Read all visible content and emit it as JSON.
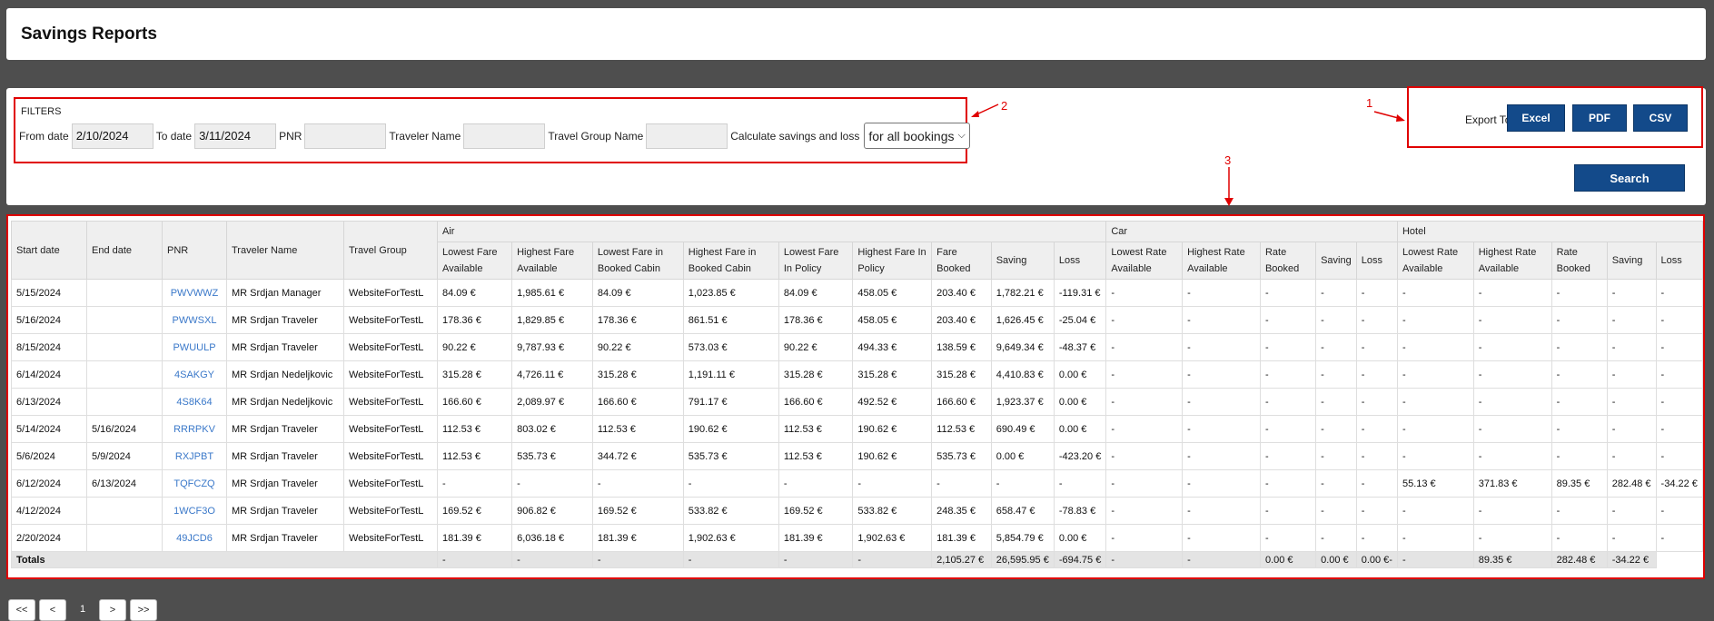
{
  "page": {
    "title": "Savings Reports"
  },
  "filters": {
    "label": "FILTERS",
    "from_date_label": "From date",
    "from_date": "2/10/2024",
    "to_date_label": "To date",
    "to_date": "3/11/2024",
    "pnr_label": "PNR",
    "pnr": "",
    "traveler_label": "Traveler Name",
    "traveler": "",
    "group_label": "Travel Group Name",
    "group": "",
    "calc_label": "Calculate savings and loss",
    "calc_value": "for all bookings"
  },
  "export": {
    "label": "Export To",
    "excel": "Excel",
    "pdf": "PDF",
    "csv": "CSV"
  },
  "search_button": "Search",
  "annotations": {
    "a1": "1",
    "a2": "2",
    "a3": "3"
  },
  "table": {
    "groups": {
      "air": "Air",
      "car": "Car",
      "hotel": "Hotel"
    },
    "headers": {
      "start": "Start date",
      "end": "End date",
      "pnr": "PNR",
      "traveler": "Traveler Name",
      "group": "Travel Group",
      "air": [
        "Lowest Fare Available",
        "Highest Fare Available",
        "Lowest Fare in Booked Cabin",
        "Highest Fare in Booked Cabin",
        "Lowest Fare In Policy",
        "Highest Fare In Policy",
        "Fare Booked",
        "Saving",
        "Loss"
      ],
      "car": [
        "Lowest Rate Available",
        "Highest Rate Available",
        "Rate Booked",
        "Saving",
        "Loss"
      ],
      "hotel": [
        "Lowest Rate Available",
        "Highest Rate Available",
        "Rate Booked",
        "Saving",
        "Loss"
      ]
    },
    "rows": [
      [
        "5/15/2024",
        "",
        "PWVWWZ",
        "MR Srdjan Manager",
        "WebsiteForTestL",
        "84.09 €",
        "1,985.61 €",
        "84.09 €",
        "1,023.85 €",
        "84.09 €",
        "458.05 €",
        "203.40 €",
        "1,782.21 €",
        "-119.31 €",
        "-",
        "-",
        "-",
        "-",
        "-",
        "-",
        "-",
        "-",
        "-",
        "-"
      ],
      [
        "5/16/2024",
        "",
        "PWWSXL",
        "MR Srdjan Traveler",
        "WebsiteForTestL",
        "178.36 €",
        "1,829.85 €",
        "178.36 €",
        "861.51 €",
        "178.36 €",
        "458.05 €",
        "203.40 €",
        "1,626.45 €",
        "-25.04 €",
        "-",
        "-",
        "-",
        "-",
        "-",
        "-",
        "-",
        "-",
        "-",
        "-"
      ],
      [
        "8/15/2024",
        "",
        "PWUULP",
        "MR Srdjan Traveler",
        "WebsiteForTestL",
        "90.22 €",
        "9,787.93 €",
        "90.22 €",
        "573.03 €",
        "90.22 €",
        "494.33 €",
        "138.59 €",
        "9,649.34 €",
        "-48.37 €",
        "-",
        "-",
        "-",
        "-",
        "-",
        "-",
        "-",
        "-",
        "-",
        "-"
      ],
      [
        "6/14/2024",
        "",
        "4SAKGY",
        "MR Srdjan Nedeljkovic",
        "WebsiteForTestL",
        "315.28 €",
        "4,726.11 €",
        "315.28 €",
        "1,191.11 €",
        "315.28 €",
        "315.28 €",
        "315.28 €",
        "4,410.83 €",
        "0.00 €",
        "-",
        "-",
        "-",
        "-",
        "-",
        "-",
        "-",
        "-",
        "-",
        "-"
      ],
      [
        "6/13/2024",
        "",
        "4S8K64",
        "MR Srdjan Nedeljkovic",
        "WebsiteForTestL",
        "166.60 €",
        "2,089.97 €",
        "166.60 €",
        "791.17 €",
        "166.60 €",
        "492.52 €",
        "166.60 €",
        "1,923.37 €",
        "0.00 €",
        "-",
        "-",
        "-",
        "-",
        "-",
        "-",
        "-",
        "-",
        "-",
        "-"
      ],
      [
        "5/14/2024",
        "5/16/2024",
        "RRRPKV",
        "MR Srdjan Traveler",
        "WebsiteForTestL",
        "112.53 €",
        "803.02 €",
        "112.53 €",
        "190.62 €",
        "112.53 €",
        "190.62 €",
        "112.53 €",
        "690.49 €",
        "0.00 €",
        "-",
        "-",
        "-",
        "-",
        "-",
        "-",
        "-",
        "-",
        "-",
        "-"
      ],
      [
        "5/6/2024",
        "5/9/2024",
        "RXJPBT",
        "MR Srdjan Traveler",
        "WebsiteForTestL",
        "112.53 €",
        "535.73 €",
        "344.72 €",
        "535.73 €",
        "112.53 €",
        "190.62 €",
        "535.73 €",
        "0.00 €",
        "-423.20 €",
        "-",
        "-",
        "-",
        "-",
        "-",
        "-",
        "-",
        "-",
        "-",
        "-"
      ],
      [
        "6/12/2024",
        "6/13/2024",
        "TQFCZQ",
        "MR Srdjan Traveler",
        "WebsiteForTestL",
        "-",
        "-",
        "-",
        "-",
        "-",
        "-",
        "-",
        "-",
        "-",
        "-",
        "-",
        "-",
        "-",
        "-",
        "55.13 €",
        "371.83 €",
        "89.35 €",
        "282.48 €",
        "-34.22 €"
      ],
      [
        "4/12/2024",
        "",
        "1WCF3O",
        "MR Srdjan Traveler",
        "WebsiteForTestL",
        "169.52 €",
        "906.82 €",
        "169.52 €",
        "533.82 €",
        "169.52 €",
        "533.82 €",
        "248.35 €",
        "658.47 €",
        "-78.83 €",
        "-",
        "-",
        "-",
        "-",
        "-",
        "-",
        "-",
        "-",
        "-",
        "-"
      ],
      [
        "2/20/2024",
        "",
        "49JCD6",
        "MR Srdjan Traveler",
        "WebsiteForTestL",
        "181.39 €",
        "6,036.18 €",
        "181.39 €",
        "1,902.63 €",
        "181.39 €",
        "1,902.63 €",
        "181.39 €",
        "5,854.79 €",
        "0.00 €",
        "-",
        "-",
        "-",
        "-",
        "-",
        "-",
        "-",
        "-",
        "-",
        "-"
      ]
    ],
    "totals_label": "Totals",
    "totals": [
      "-",
      "-",
      "-",
      "-",
      "-",
      "-",
      "2,105.27 €",
      "26,595.95 €",
      "-694.75 €",
      "-",
      "-",
      "0.00 €",
      "0.00 €",
      "0.00 €-",
      "-",
      "89.35 €",
      "282.48 €",
      "-34.22 €"
    ]
  },
  "pager": {
    "first": "<<",
    "prev": "<",
    "page": "1",
    "next": ">",
    "last": ">>"
  }
}
